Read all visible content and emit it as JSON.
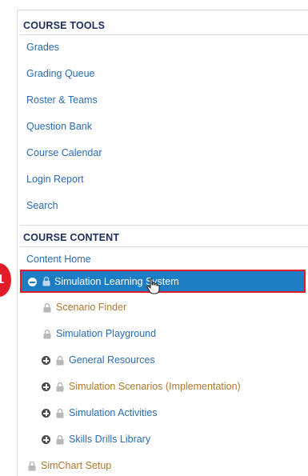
{
  "course_tools": {
    "header": "COURSE TOOLS",
    "items": [
      {
        "label": "Grades"
      },
      {
        "label": "Grading Queue"
      },
      {
        "label": "Roster & Teams"
      },
      {
        "label": "Question Bank"
      },
      {
        "label": "Course Calendar"
      },
      {
        "label": "Login Report"
      },
      {
        "label": "Search"
      }
    ]
  },
  "course_content": {
    "header": "COURSE CONTENT",
    "content_home": "Content Home",
    "selected_item": {
      "label": "Simulation Learning System",
      "expanded": true
    },
    "children": [
      {
        "label": "Scenario Finder",
        "has_toggle": false,
        "color": "#b07a2e"
      },
      {
        "label": "Simulation Playground",
        "has_toggle": false,
        "color": "#2a6db5"
      },
      {
        "label": "General Resources",
        "has_toggle": true,
        "color": "#2a6db5"
      },
      {
        "label": "Simulation Scenarios (Implementation)",
        "has_toggle": true,
        "color": "#b07a2e"
      },
      {
        "label": "Simulation Activities",
        "has_toggle": true,
        "color": "#2a6db5"
      },
      {
        "label": "Skills Drills Library",
        "has_toggle": true,
        "color": "#2a6db5"
      }
    ],
    "simchart": {
      "label": "SimChart Setup",
      "color": "#b07a2e"
    }
  },
  "annotation": {
    "step_badge": "1",
    "highlight_color": "#e21d2a"
  },
  "colors": {
    "link": "#2a6db5",
    "header": "#1b2f5a",
    "selected_bg": "#1c7cc4",
    "tan_link": "#b07a2e"
  },
  "icons": {
    "expand": "plus-circle-icon",
    "collapse": "minus-circle-icon",
    "lock": "lock-icon",
    "cursor": "hand-pointer-icon"
  }
}
